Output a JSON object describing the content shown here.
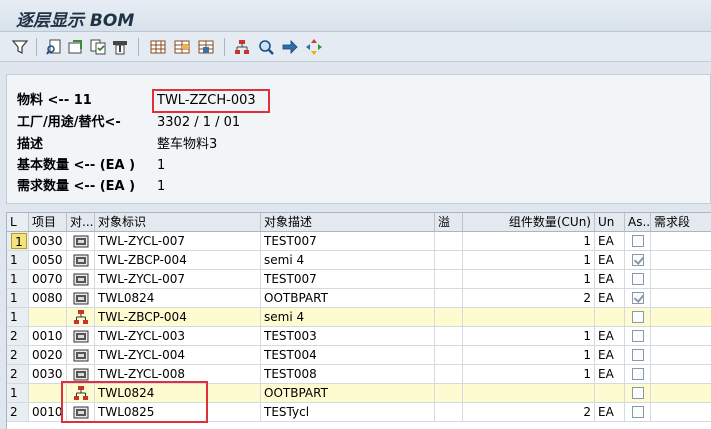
{
  "window": {
    "title": "逐层显示 BOM"
  },
  "toolbar": {
    "icons": [
      "filter-icon",
      "find-icon",
      "refresh-icon",
      "copy-icon",
      "print-icon",
      "grid-icon",
      "columns-icon",
      "layout-icon",
      "hierarchy-icon",
      "zoom-icon",
      "forward-icon",
      "colors-icon"
    ]
  },
  "header": {
    "material_label": "物料 <-- 11",
    "material_value": "TWL-ZZCH-003",
    "plant_label": "工厂/用途/替代<-",
    "plant_value": "3302 / 1 / 01",
    "desc_label": "描述",
    "desc_value": "整车物料3",
    "base_qty_label": "基本数量 <-- (EA )",
    "base_qty_value": "1",
    "req_qty_label": "需求数量 <-- (EA )",
    "req_qty_value": "1"
  },
  "table": {
    "columns": {
      "level": "L",
      "item": "项目",
      "obj": "对...",
      "obj_id": "对象标识",
      "obj_desc": "对象描述",
      "overflow": "溢",
      "qty": "组件数量(CUn)",
      "unit": "Un",
      "assembly": "As...",
      "req_seg": "需求段"
    },
    "rows": [
      {
        "level": "1",
        "item": "0030",
        "icon": "material-icon",
        "id": "TWL-ZYCL-007",
        "desc": "TEST007",
        "qty": "1",
        "unit": "EA",
        "checked": false,
        "highlight": "white",
        "tagged": true
      },
      {
        "level": "1",
        "item": "0050",
        "icon": "material-icon",
        "id": "TWL-ZBCP-004",
        "desc": "semi 4",
        "qty": "1",
        "unit": "EA",
        "checked": true,
        "highlight": "white",
        "tagged": false
      },
      {
        "level": "1",
        "item": "0070",
        "icon": "material-icon",
        "id": "TWL-ZYCL-007",
        "desc": "TEST007",
        "qty": "1",
        "unit": "EA",
        "checked": false,
        "highlight": "white",
        "tagged": false
      },
      {
        "level": "1",
        "item": "0080",
        "icon": "material-icon",
        "id": "TWL0824",
        "desc": "OOTBPART",
        "qty": "2",
        "unit": "EA",
        "checked": true,
        "highlight": "white",
        "tagged": false
      },
      {
        "level": "1",
        "item": "",
        "icon": "bom-icon",
        "id": "TWL-ZBCP-004",
        "desc": "semi 4",
        "qty": "",
        "unit": "",
        "checked": false,
        "highlight": "yellow",
        "tagged": false
      },
      {
        "level": "2",
        "item": "0010",
        "icon": "material-icon",
        "id": "TWL-ZYCL-003",
        "desc": "TEST003",
        "qty": "1",
        "unit": "EA",
        "checked": false,
        "highlight": "white",
        "tagged": false
      },
      {
        "level": "2",
        "item": "0020",
        "icon": "material-icon",
        "id": "TWL-ZYCL-004",
        "desc": "TEST004",
        "qty": "1",
        "unit": "EA",
        "checked": false,
        "highlight": "white",
        "tagged": false
      },
      {
        "level": "2",
        "item": "0030",
        "icon": "material-icon",
        "id": "TWL-ZYCL-008",
        "desc": "TEST008",
        "qty": "1",
        "unit": "EA",
        "checked": false,
        "highlight": "white",
        "tagged": false
      },
      {
        "level": "1",
        "item": "",
        "icon": "bom-icon",
        "id": "TWL0824",
        "desc": "OOTBPART",
        "qty": "",
        "unit": "",
        "checked": false,
        "highlight": "yellow",
        "tagged": false
      },
      {
        "level": "2",
        "item": "0010",
        "icon": "material-icon",
        "id": "TWL0825",
        "desc": "TESTycl",
        "qty": "2",
        "unit": "EA",
        "checked": false,
        "highlight": "white",
        "tagged": false
      }
    ]
  },
  "colors": {
    "highlight_box": "#e0303a",
    "yellow_row": "#fffbd1",
    "header_bg": "#f2f5f8"
  }
}
